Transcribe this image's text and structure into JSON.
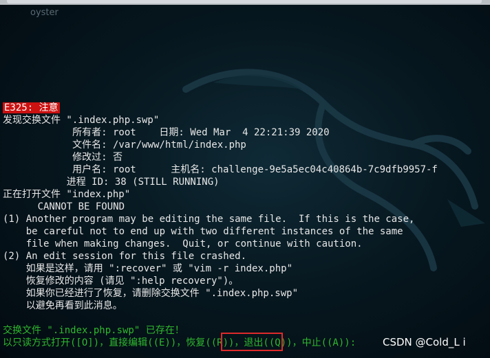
{
  "window": {
    "host_label": "oyster"
  },
  "terminal": {
    "error_code": "E325: 注意",
    "lines": [
      "发现交换文件 \".index.php.swp\"",
      "            所有者: root    日期: Wed Mar  4 22:21:39 2020",
      "            文件名: /var/www/html/index.php",
      "            修改过: 否",
      "            用户名: root      主机名: challenge-9e5a5ec04c40864b-7c9dfb9957-f",
      "           进程 ID: 38 (STILL RUNNING)",
      "正在打开文件 \"index.php\"",
      "      CANNOT BE FOUND",
      "(1) Another program may be editing the same file.  If this is the case,",
      "    be careful not to end up with two different instances of the same",
      "    file when making changes.  Quit, or continue with caution.",
      "(2) An edit session for this file crashed.",
      "    如果是这样，请用 \":recover\" 或 \"vim -r index.php\"",
      "    恢复修改的内容 (请见 \":help recovery\")。",
      "    如果你已经进行了恢复，请删除交换文件 \".index.php.swp\"",
      "    以避免再看到此消息。"
    ],
    "prompt_title": "交换文件 \".index.php.swp\" 已存在！",
    "prompt_options": "以只读方式打开([O])，直接编辑((E))，恢复((R))，退出((Q))，中止((A)):"
  },
  "watermark": "CSDN @Cold_L i"
}
